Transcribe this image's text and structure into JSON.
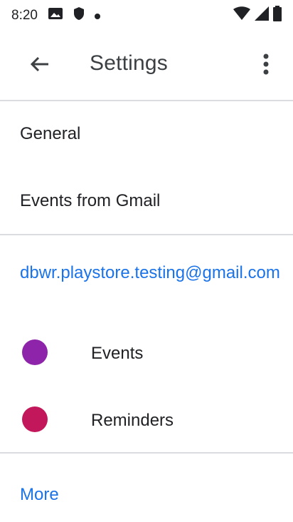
{
  "status_bar": {
    "time": "8:20",
    "icons": [
      "gallery-icon",
      "shield-icon",
      "dot-icon",
      "wifi-icon",
      "signal-icon",
      "battery-icon"
    ]
  },
  "app_bar": {
    "title": "Settings",
    "back_icon": "arrow-back-icon",
    "menu_icon": "more-vert-icon"
  },
  "sections": {
    "general": "General",
    "events_from_gmail": "Events from Gmail"
  },
  "account": {
    "email": "dbwr.playstore.testing@gmail.com",
    "calendars": [
      {
        "label": "Events",
        "color": "#8e24aa"
      },
      {
        "label": "Reminders",
        "color": "#c2185b"
      }
    ]
  },
  "more_link": "More",
  "colors": {
    "accent": "#1a73e8",
    "divider": "#dadce0"
  }
}
